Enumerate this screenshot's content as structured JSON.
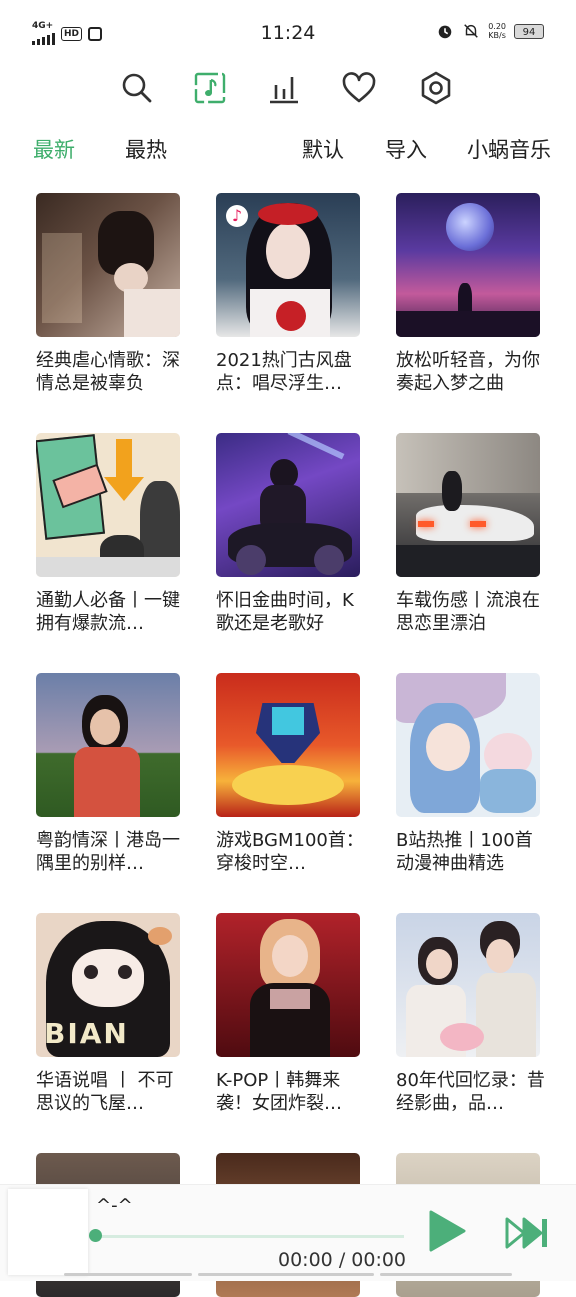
{
  "status_bar": {
    "network": "4G+",
    "hd": "HD",
    "time": "11:24",
    "speed_value": "0.20",
    "speed_unit": "KB/s",
    "battery": "94"
  },
  "nav": {
    "icons": [
      "search-icon",
      "music-note-icon",
      "bar-chart-icon",
      "heart-icon",
      "settings-hexagon-icon"
    ],
    "active_color": "#3fae6c"
  },
  "tabs": {
    "latest": "最新",
    "hottest": "最热",
    "default": "默认",
    "import": "导入",
    "source": "小蜗音乐"
  },
  "playlists": [
    {
      "title": "经典虐心情歌：深情总是被辜负"
    },
    {
      "title": "2021热门古风盘点：唱尽浮生…"
    },
    {
      "title": "放松听轻音，为你奏起入梦之曲"
    },
    {
      "title": "通勤人必备丨一键拥有爆款流…"
    },
    {
      "title": "怀旧金曲时间，K歌还是老歌好"
    },
    {
      "title": "车载伤感丨流浪在思恋里漂泊"
    },
    {
      "title": "粤韵情深丨港岛一隅里的别样…"
    },
    {
      "title": "游戏BGM100首：穿梭时空…"
    },
    {
      "title": "B站热推丨100首动漫神曲精选"
    },
    {
      "title": "华语说唱 丨 不可思议的飞屋…"
    },
    {
      "title": "K-POP丨韩舞来袭！女团炸裂…"
    },
    {
      "title": "80年代回忆录：昔经影曲，品…"
    }
  ],
  "player": {
    "song": "^-^",
    "current_time": "00:00",
    "separator": "/",
    "total_time": "00:00",
    "progress": 0,
    "accent": "#4caf7a"
  }
}
